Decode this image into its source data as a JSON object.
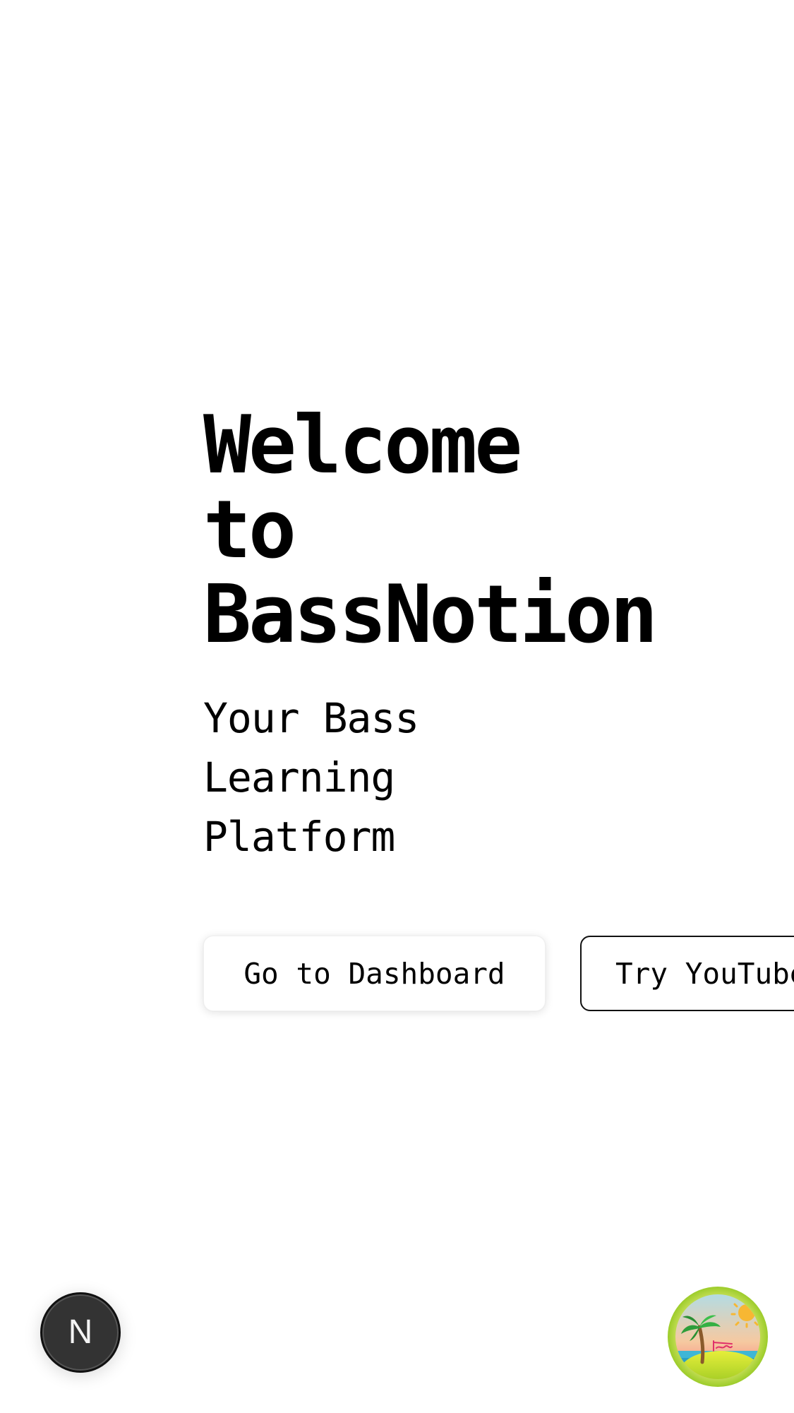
{
  "hero": {
    "title_lines": [
      "Welcome",
      "to",
      "BassNotion"
    ],
    "subtitle_lines": [
      "Your Bass",
      "Learning",
      "Platform"
    ]
  },
  "actions": {
    "dashboard_label": "Go to Dashboard",
    "youtube_label": "Try YouTube"
  },
  "floating": {
    "next_letter": "N",
    "next_icon": "nextjs-logo-icon",
    "island_icon": "tropical-island-icon"
  },
  "colors": {
    "background": "#ffffff",
    "text": "#000000",
    "fab_dark": "#333333"
  }
}
